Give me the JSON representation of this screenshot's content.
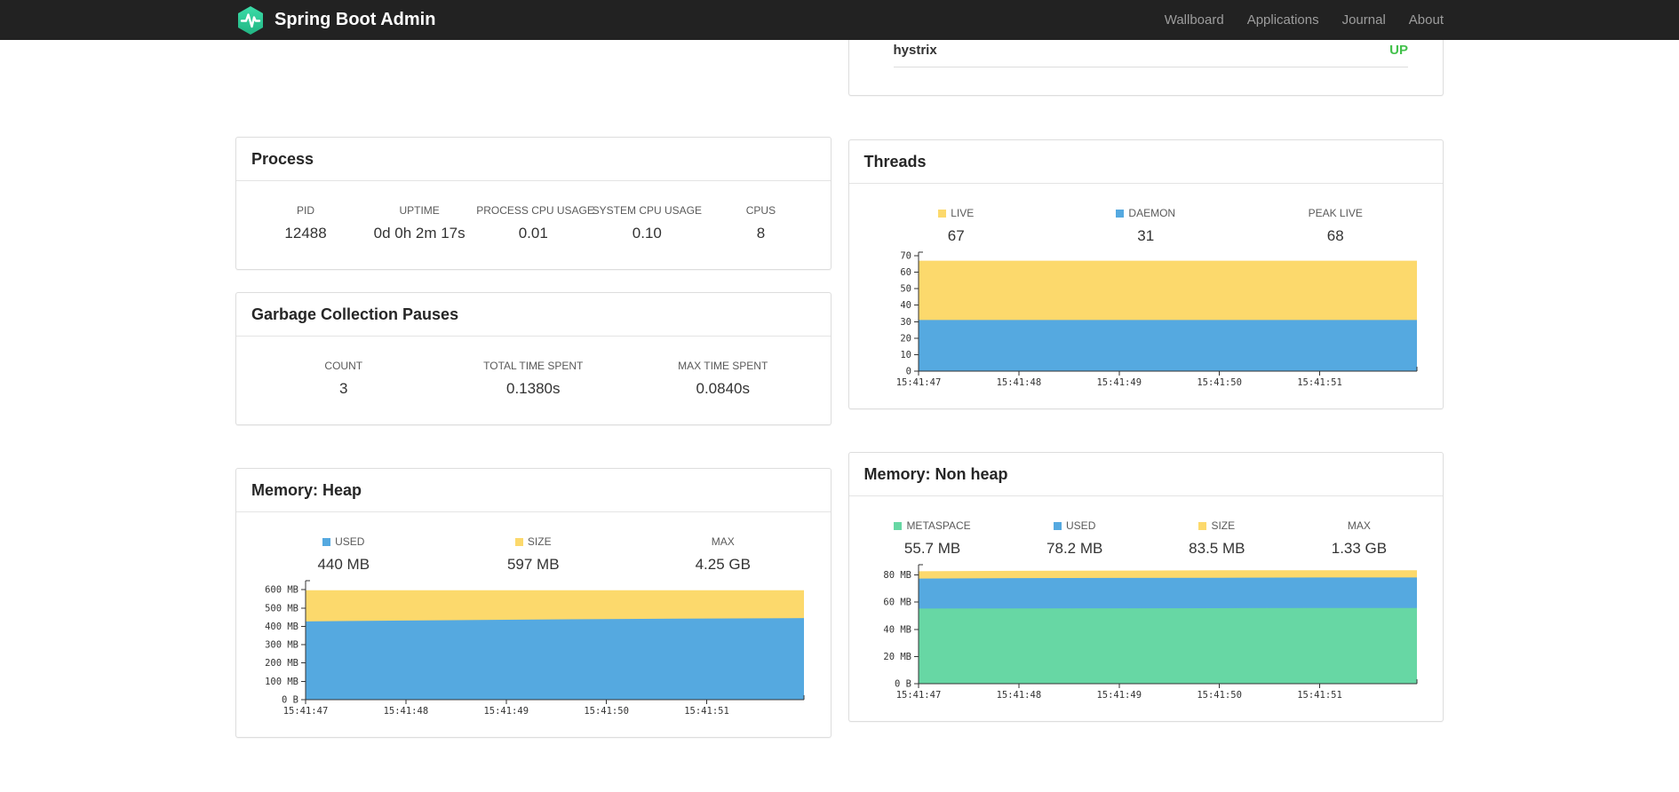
{
  "navbar": {
    "brand": "Spring Boot Admin",
    "items": [
      {
        "label": "Wallboard"
      },
      {
        "label": "Applications"
      },
      {
        "label": "Journal"
      },
      {
        "label": "About"
      }
    ]
  },
  "colors": {
    "navbar_bg": "#222222",
    "brand_logo": "#2fcf9b",
    "chart_yellow": "#fcd96c",
    "chart_blue": "#55a9e0",
    "chart_green": "#67d7a4",
    "status_up": "#42c14b"
  },
  "status_card": {
    "rows": [
      {
        "name": "hystrix",
        "status": "UP",
        "status_color": "#42c14b"
      }
    ]
  },
  "process": {
    "title": "Process",
    "stats": [
      {
        "label": "PID",
        "value": "12488"
      },
      {
        "label": "UPTIME",
        "value": "0d 0h 2m 17s"
      },
      {
        "label": "PROCESS CPU USAGE",
        "value": "0.01"
      },
      {
        "label": "SYSTEM CPU USAGE",
        "value": "0.10"
      },
      {
        "label": "CPUS",
        "value": "8"
      }
    ]
  },
  "gc": {
    "title": "Garbage Collection Pauses",
    "stats": [
      {
        "label": "COUNT",
        "value": "3"
      },
      {
        "label": "TOTAL TIME SPENT",
        "value": "0.1380s"
      },
      {
        "label": "MAX TIME SPENT",
        "value": "0.0840s"
      }
    ]
  },
  "threads": {
    "title": "Threads",
    "stats": [
      {
        "label": "LIVE",
        "value": "67",
        "legend": "#fcd96c"
      },
      {
        "label": "DAEMON",
        "value": "31",
        "legend": "#55a9e0"
      },
      {
        "label": "PEAK LIVE",
        "value": "68"
      }
    ]
  },
  "heap": {
    "title": "Memory: Heap",
    "stats": [
      {
        "label": "USED",
        "value": "440 MB",
        "legend": "#55a9e0"
      },
      {
        "label": "SIZE",
        "value": "597 MB",
        "legend": "#fcd96c"
      },
      {
        "label": "MAX",
        "value": "4.25 GB"
      }
    ]
  },
  "nonheap": {
    "title": "Memory: Non heap",
    "stats": [
      {
        "label": "METASPACE",
        "value": "55.7 MB",
        "legend": "#67d7a4"
      },
      {
        "label": "USED",
        "value": "78.2 MB",
        "legend": "#55a9e0"
      },
      {
        "label": "SIZE",
        "value": "83.5 MB",
        "legend": "#fcd96c"
      },
      {
        "label": "MAX",
        "value": "1.33 GB"
      }
    ]
  },
  "chart_data": [
    {
      "id": "threads",
      "type": "area",
      "title": "Threads",
      "xlabel": "",
      "ylabel": "",
      "grid": false,
      "legend_position": "top",
      "x": [
        "15:41:47",
        "15:41:48",
        "15:41:49",
        "15:41:50",
        "15:41:51"
      ],
      "ylim": [
        0,
        70
      ],
      "yticks": [
        {
          "value": 0,
          "label": "0"
        },
        {
          "value": 10,
          "label": "10"
        },
        {
          "value": 20,
          "label": "20"
        },
        {
          "value": 30,
          "label": "30"
        },
        {
          "value": 40,
          "label": "40"
        },
        {
          "value": 50,
          "label": "50"
        },
        {
          "value": 60,
          "label": "60"
        },
        {
          "value": 70,
          "label": "70"
        }
      ],
      "series": [
        {
          "name": "LIVE",
          "color": "#fcd96c",
          "values": [
            67,
            67,
            67,
            67,
            67,
            67
          ]
        },
        {
          "name": "DAEMON",
          "color": "#55a9e0",
          "values": [
            31,
            31,
            31,
            31,
            31,
            31
          ]
        }
      ]
    },
    {
      "id": "heap",
      "type": "area",
      "title": "Memory: Heap",
      "xlabel": "",
      "ylabel": "",
      "grid": false,
      "legend_position": "top",
      "x": [
        "15:41:47",
        "15:41:48",
        "15:41:49",
        "15:41:50",
        "15:41:51"
      ],
      "ylim": [
        0,
        630
      ],
      "yticks": [
        {
          "value": 0,
          "label": "0 B"
        },
        {
          "value": 100,
          "label": "100 MB"
        },
        {
          "value": 200,
          "label": "200 MB"
        },
        {
          "value": 300,
          "label": "300 MB"
        },
        {
          "value": 400,
          "label": "400 MB"
        },
        {
          "value": 500,
          "label": "500 MB"
        },
        {
          "value": 600,
          "label": "600 MB"
        }
      ],
      "series": [
        {
          "name": "SIZE",
          "color": "#fcd96c",
          "values": [
            597,
            597,
            597,
            597,
            597,
            597
          ]
        },
        {
          "name": "USED",
          "color": "#55a9e0",
          "values": [
            427,
            432,
            436,
            440,
            443,
            445
          ]
        }
      ]
    },
    {
      "id": "nonheap",
      "type": "area",
      "title": "Memory: Non heap",
      "xlabel": "",
      "ylabel": "",
      "grid": false,
      "legend_position": "top",
      "x": [
        "15:41:47",
        "15:41:48",
        "15:41:49",
        "15:41:50",
        "15:41:51"
      ],
      "ylim": [
        0,
        85
      ],
      "yticks": [
        {
          "value": 0,
          "label": "0 B"
        },
        {
          "value": 20,
          "label": "20 MB"
        },
        {
          "value": 40,
          "label": "40 MB"
        },
        {
          "value": 60,
          "label": "60 MB"
        },
        {
          "value": 80,
          "label": "80 MB"
        }
      ],
      "series": [
        {
          "name": "SIZE",
          "color": "#fcd96c",
          "values": [
            82.8,
            83.1,
            83.3,
            83.5,
            83.5,
            83.5
          ]
        },
        {
          "name": "USED",
          "color": "#55a9e0",
          "values": [
            77.4,
            77.7,
            77.9,
            78.0,
            78.2,
            78.2
          ]
        },
        {
          "name": "METASPACE",
          "color": "#67d7a4",
          "values": [
            55.3,
            55.4,
            55.5,
            55.6,
            55.7,
            55.7
          ]
        }
      ]
    }
  ]
}
